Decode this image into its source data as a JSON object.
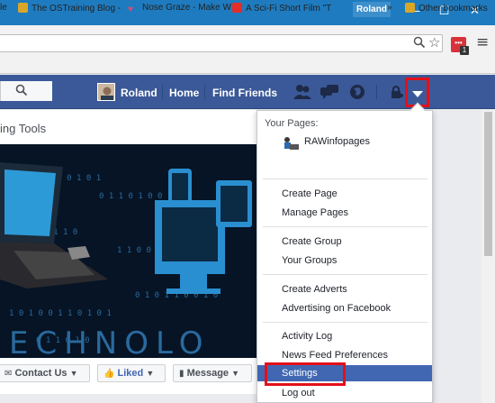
{
  "window": {
    "profile_badge": "Roland",
    "minimize_glyph": "—",
    "maximize_glyph": "☐",
    "close_glyph": "✕"
  },
  "toolbar": {
    "zoom_icon": "zoom-icon",
    "star_icon": "star-icon",
    "extension_badge": "1",
    "menu_glyph": "≡"
  },
  "bookmarks": [
    {
      "label": "le",
      "icon": "page-icon"
    },
    {
      "label": "The OSTraining Blog -",
      "icon": "folder-icon"
    },
    {
      "label": "Nose Graze - Make W",
      "icon": "heart-icon"
    },
    {
      "label": "A Sci-Fi Short Film \"T",
      "icon": "youtube-icon"
    },
    {
      "label": "»",
      "icon": "chevron-icon"
    },
    {
      "label": "Other bookmarks",
      "icon": "folder-icon"
    }
  ],
  "facebook": {
    "user_name": "Roland",
    "nav_home": "Home",
    "nav_find_friends": "Find Friends",
    "brand_color": "#3b5998"
  },
  "page": {
    "tools_label": "ing Tools",
    "action_contact": "Contact Us",
    "action_liked": "Liked",
    "action_message": "Message"
  },
  "dropdown": {
    "your_pages_title": "Your Pages:",
    "page_name": "RAWinfopages",
    "groups": [
      [
        "Create Page",
        "Manage Pages"
      ],
      [
        "Create Group",
        "Your Groups"
      ],
      [
        "Create Adverts",
        "Advertising on Facebook"
      ],
      [
        "Activity Log",
        "News Feed Preferences",
        "Settings",
        "Log out"
      ]
    ],
    "selected_item": "Settings",
    "highlight_color": "#e3101a"
  }
}
